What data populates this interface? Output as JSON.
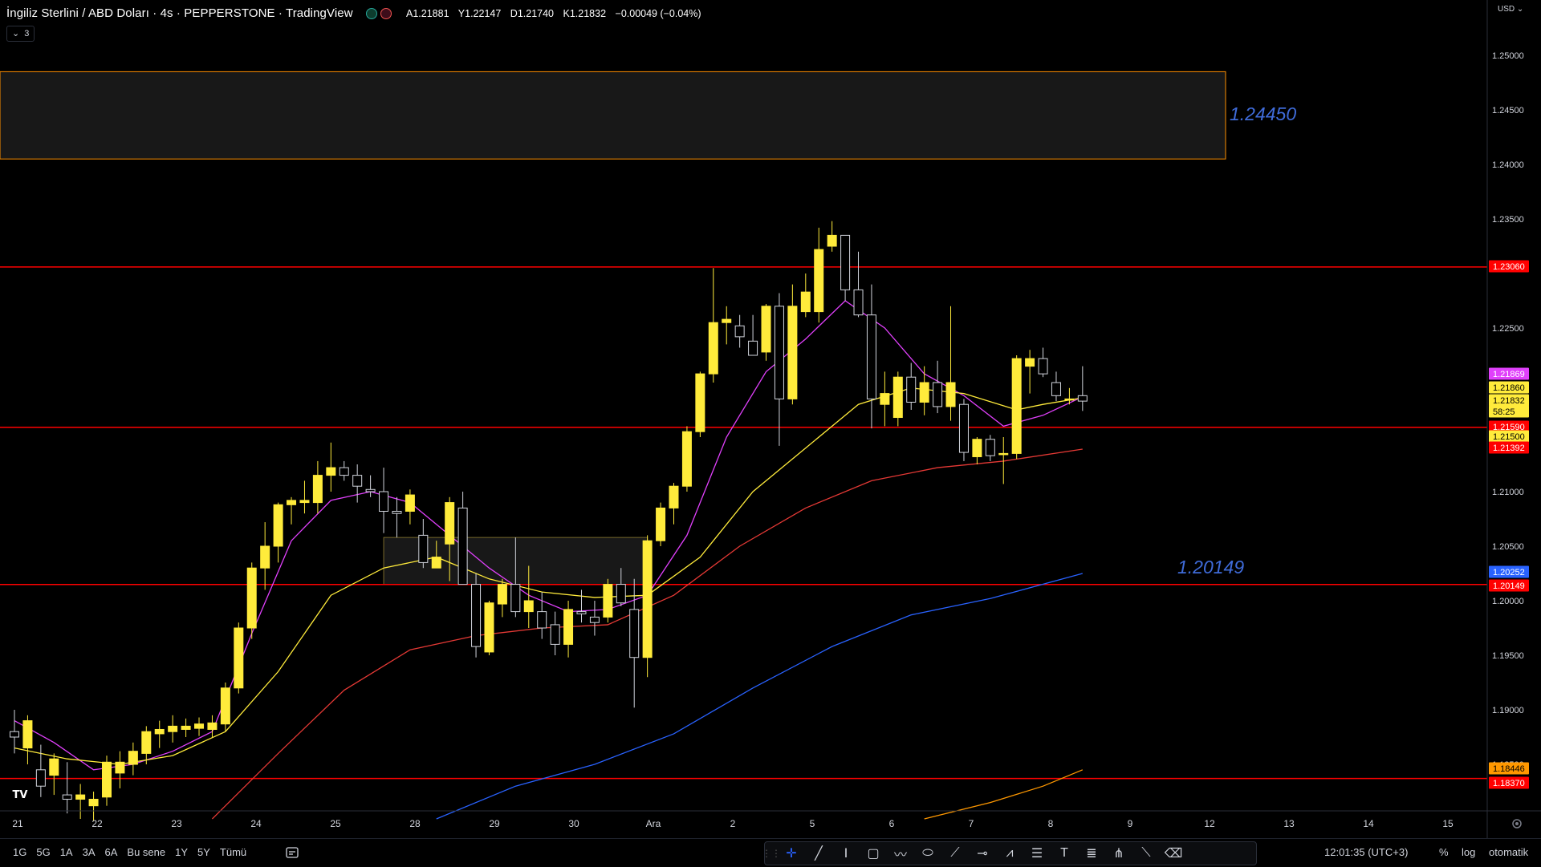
{
  "header": {
    "title": "İngiliz Sterlini / ABD Doları · 4s · PEPPERSTONE · TradingView",
    "ohlc": {
      "open": "A1.21881",
      "high": "Y1.22147",
      "low": "D1.21740",
      "close": "K1.21832",
      "change": "−0.00049 (−0.04%)"
    },
    "indicator_count": "3"
  },
  "price_scale": {
    "currency": "USD"
  },
  "annotations": {
    "upper_label": "1.24450",
    "lower_label": "1.20149"
  },
  "price_badges": [
    {
      "value": "1.23060",
      "color": "#ff0000"
    },
    {
      "value": "1.21869",
      "color": "#e040fb"
    },
    {
      "value": "1.21860",
      "color": "#ffeb3b"
    },
    {
      "value": "1.21832",
      "color": "#ffeb3b"
    },
    {
      "value": "58:25",
      "color": "#ffeb3b"
    },
    {
      "value": "1.21590",
      "color": "#ff0000"
    },
    {
      "value": "1.21500",
      "color": "#ffeb3b"
    },
    {
      "value": "1.21392",
      "color": "#ff0000"
    },
    {
      "value": "1.20252",
      "color": "#2962ff"
    },
    {
      "value": "1.20149",
      "color": "#ff0000"
    },
    {
      "value": "1.18446",
      "color": "#ff9800"
    },
    {
      "value": "1.18370",
      "color": "#ff0000"
    }
  ],
  "bottom_bar": {
    "ranges": [
      "1G",
      "5G",
      "1A",
      "3A",
      "6A",
      "Bu sene",
      "1Y",
      "5Y",
      "Tümü"
    ],
    "clock": "12:01:35 (UTC+3)",
    "percent": "%",
    "log": "log",
    "auto": "otomatik"
  },
  "drawing_tools": [
    "crosshair-icon",
    "trend-line-icon",
    "text-cursor-icon",
    "rectangle-icon",
    "brush-icon",
    "ellipse-icon",
    "path-icon",
    "horizontal-ray-icon",
    "zigzag-icon",
    "horizontal-lines-icon",
    "text-icon",
    "fib-icon",
    "pitchfork-icon",
    "ruler-icon",
    "eraser-icon"
  ],
  "chart_data": {
    "type": "candlestick",
    "symbol": "GBPUSD",
    "timeframe": "4s",
    "ylim": [
      1.18,
      1.2525
    ],
    "y_ticks": [
      1.25,
      1.245,
      1.24,
      1.235,
      1.225,
      1.21,
      1.205,
      1.2,
      1.195,
      1.19,
      1.185
    ],
    "x_ticks": [
      "21",
      "22",
      "23",
      "24",
      "25",
      "28",
      "29",
      "30",
      "Ara",
      "2",
      "5",
      "6",
      "7",
      "8",
      "9",
      "12",
      "13",
      "14",
      "15"
    ],
    "horizontal_levels": [
      1.2306,
      1.2159,
      1.20149,
      1.1837
    ],
    "zones": [
      {
        "from": 1.2405,
        "to": 1.2485
      },
      {
        "from": 1.2015,
        "to": 1.2058
      }
    ],
    "candles": [
      {
        "o": 1.188,
        "h": 1.19,
        "l": 1.186,
        "c": 1.1875
      },
      {
        "o": 1.1865,
        "h": 1.1895,
        "l": 1.185,
        "c": 1.189
      },
      {
        "o": 1.1845,
        "h": 1.1868,
        "l": 1.182,
        "c": 1.183
      },
      {
        "o": 1.184,
        "h": 1.186,
        "l": 1.1822,
        "c": 1.1855
      },
      {
        "o": 1.1822,
        "h": 1.1852,
        "l": 1.1805,
        "c": 1.1818
      },
      {
        "o": 1.1818,
        "h": 1.1832,
        "l": 1.18,
        "c": 1.1822
      },
      {
        "o": 1.1812,
        "h": 1.1825,
        "l": 1.1798,
        "c": 1.1818
      },
      {
        "o": 1.182,
        "h": 1.1858,
        "l": 1.1812,
        "c": 1.1852
      },
      {
        "o": 1.1842,
        "h": 1.1862,
        "l": 1.1828,
        "c": 1.1852
      },
      {
        "o": 1.185,
        "h": 1.187,
        "l": 1.184,
        "c": 1.1862
      },
      {
        "o": 1.186,
        "h": 1.1885,
        "l": 1.185,
        "c": 1.188
      },
      {
        "o": 1.1878,
        "h": 1.189,
        "l": 1.1865,
        "c": 1.1882
      },
      {
        "o": 1.188,
        "h": 1.1895,
        "l": 1.187,
        "c": 1.1885
      },
      {
        "o": 1.1882,
        "h": 1.1892,
        "l": 1.1875,
        "c": 1.1885
      },
      {
        "o": 1.1883,
        "h": 1.1893,
        "l": 1.1876,
        "c": 1.1887
      },
      {
        "o": 1.1882,
        "h": 1.1895,
        "l": 1.1875,
        "c": 1.1888
      },
      {
        "o": 1.1887,
        "h": 1.1925,
        "l": 1.188,
        "c": 1.192
      },
      {
        "o": 1.192,
        "h": 1.198,
        "l": 1.1915,
        "c": 1.1975
      },
      {
        "o": 1.1975,
        "h": 1.2035,
        "l": 1.1965,
        "c": 1.203
      },
      {
        "o": 1.203,
        "h": 1.2072,
        "l": 1.201,
        "c": 1.205
      },
      {
        "o": 1.205,
        "h": 1.209,
        "l": 1.2035,
        "c": 1.2088
      },
      {
        "o": 1.2088,
        "h": 1.2095,
        "l": 1.207,
        "c": 1.2092
      },
      {
        "o": 1.209,
        "h": 1.211,
        "l": 1.208,
        "c": 1.2092
      },
      {
        "o": 1.209,
        "h": 1.2128,
        "l": 1.208,
        "c": 1.2115
      },
      {
        "o": 1.2115,
        "h": 1.2145,
        "l": 1.21,
        "c": 1.2122
      },
      {
        "o": 1.2122,
        "h": 1.2128,
        "l": 1.211,
        "c": 1.2115
      },
      {
        "o": 1.2115,
        "h": 1.2125,
        "l": 1.209,
        "c": 1.2105
      },
      {
        "o": 1.2102,
        "h": 1.2115,
        "l": 1.2095,
        "c": 1.21
      },
      {
        "o": 1.21,
        "h": 1.2122,
        "l": 1.2062,
        "c": 1.2082
      },
      {
        "o": 1.2082,
        "h": 1.2095,
        "l": 1.2058,
        "c": 1.208
      },
      {
        "o": 1.2082,
        "h": 1.2102,
        "l": 1.207,
        "c": 1.2097
      },
      {
        "o": 1.206,
        "h": 1.2075,
        "l": 1.203,
        "c": 1.2035
      },
      {
        "o": 1.203,
        "h": 1.2055,
        "l": 1.203,
        "c": 1.204
      },
      {
        "o": 1.2052,
        "h": 1.2095,
        "l": 1.2018,
        "c": 1.209
      },
      {
        "o": 1.2085,
        "h": 1.21,
        "l": 1.204,
        "c": 1.2015
      },
      {
        "o": 1.2015,
        "h": 1.2025,
        "l": 1.1948,
        "c": 1.1958
      },
      {
        "o": 1.1953,
        "h": 1.2,
        "l": 1.195,
        "c": 1.1998
      },
      {
        "o": 1.1997,
        "h": 1.202,
        "l": 1.1985,
        "c": 1.2015
      },
      {
        "o": 1.2015,
        "h": 1.2058,
        "l": 1.1985,
        "c": 1.199
      },
      {
        "o": 1.199,
        "h": 1.2032,
        "l": 1.1975,
        "c": 1.2
      },
      {
        "o": 1.199,
        "h": 1.2008,
        "l": 1.1965,
        "c": 1.1975
      },
      {
        "o": 1.1978,
        "h": 1.199,
        "l": 1.195,
        "c": 1.196
      },
      {
        "o": 1.196,
        "h": 1.2,
        "l": 1.1948,
        "c": 1.1992
      },
      {
        "o": 1.199,
        "h": 1.201,
        "l": 1.198,
        "c": 1.1988
      },
      {
        "o": 1.1985,
        "h": 1.2,
        "l": 1.1968,
        "c": 1.198
      },
      {
        "o": 1.1985,
        "h": 1.202,
        "l": 1.198,
        "c": 1.2015
      },
      {
        "o": 1.2015,
        "h": 1.203,
        "l": 1.1995,
        "c": 1.1998
      },
      {
        "o": 1.1992,
        "h": 1.202,
        "l": 1.1902,
        "c": 1.1948
      },
      {
        "o": 1.1948,
        "h": 1.206,
        "l": 1.193,
        "c": 1.2055
      },
      {
        "o": 1.2055,
        "h": 1.209,
        "l": 1.205,
        "c": 1.2085
      },
      {
        "o": 1.2085,
        "h": 1.2108,
        "l": 1.207,
        "c": 1.2105
      },
      {
        "o": 1.2105,
        "h": 1.216,
        "l": 1.21,
        "c": 1.2155
      },
      {
        "o": 1.2155,
        "h": 1.221,
        "l": 1.215,
        "c": 1.2208
      },
      {
        "o": 1.2208,
        "h": 1.2305,
        "l": 1.22,
        "c": 1.2255
      },
      {
        "o": 1.2255,
        "h": 1.227,
        "l": 1.2235,
        "c": 1.2258
      },
      {
        "o": 1.2252,
        "h": 1.2262,
        "l": 1.2232,
        "c": 1.2242
      },
      {
        "o": 1.2238,
        "h": 1.2262,
        "l": 1.2225,
        "c": 1.2225
      },
      {
        "o": 1.2228,
        "h": 1.2272,
        "l": 1.222,
        "c": 1.227
      },
      {
        "o": 1.227,
        "h": 1.2282,
        "l": 1.2142,
        "c": 1.2185
      },
      {
        "o": 1.2185,
        "h": 1.229,
        "l": 1.218,
        "c": 1.227
      },
      {
        "o": 1.2265,
        "h": 1.23,
        "l": 1.226,
        "c": 1.2283
      },
      {
        "o": 1.2265,
        "h": 1.2342,
        "l": 1.2255,
        "c": 1.2322
      },
      {
        "o": 1.2325,
        "h": 1.2348,
        "l": 1.232,
        "c": 1.2335
      },
      {
        "o": 1.2335,
        "h": 1.2335,
        "l": 1.2275,
        "c": 1.2285
      },
      {
        "o": 1.2285,
        "h": 1.232,
        "l": 1.226,
        "c": 1.2262
      },
      {
        "o": 1.2262,
        "h": 1.229,
        "l": 1.2158,
        "c": 1.2185
      },
      {
        "o": 1.218,
        "h": 1.221,
        "l": 1.216,
        "c": 1.219
      },
      {
        "o": 1.2168,
        "h": 1.221,
        "l": 1.216,
        "c": 1.2205
      },
      {
        "o": 1.2205,
        "h": 1.2218,
        "l": 1.2175,
        "c": 1.2182
      },
      {
        "o": 1.2182,
        "h": 1.2215,
        "l": 1.217,
        "c": 1.22
      },
      {
        "o": 1.22,
        "h": 1.222,
        "l": 1.2172,
        "c": 1.2178
      },
      {
        "o": 1.2178,
        "h": 1.227,
        "l": 1.2165,
        "c": 1.22
      },
      {
        "o": 1.218,
        "h": 1.2185,
        "l": 1.2128,
        "c": 1.2136
      },
      {
        "o": 1.2132,
        "h": 1.215,
        "l": 1.2125,
        "c": 1.2148
      },
      {
        "o": 1.2148,
        "h": 1.2152,
        "l": 1.2128,
        "c": 1.2133
      },
      {
        "o": 1.2135,
        "h": 1.215,
        "l": 1.2107,
        "c": 1.2135
      },
      {
        "o": 1.2135,
        "h": 1.2225,
        "l": 1.213,
        "c": 1.2222
      },
      {
        "o": 1.2215,
        "h": 1.223,
        "l": 1.219,
        "c": 1.2222
      },
      {
        "o": 1.2222,
        "h": 1.2232,
        "l": 1.2205,
        "c": 1.2208
      },
      {
        "o": 1.22,
        "h": 1.221,
        "l": 1.2183,
        "c": 1.2188
      },
      {
        "o": 1.2185,
        "h": 1.2195,
        "l": 1.218,
        "c": 1.2185
      },
      {
        "o": 1.2188,
        "h": 1.2215,
        "l": 1.2174,
        "c": 1.2183
      }
    ],
    "moving_averages": [
      {
        "color": "#e040fb",
        "points": [
          [
            0,
            1.189
          ],
          [
            3,
            1.187
          ],
          [
            6,
            1.1845
          ],
          [
            9,
            1.185
          ],
          [
            12,
            1.1862
          ],
          [
            15,
            1.188
          ],
          [
            18,
            1.197
          ],
          [
            21,
            1.2055
          ],
          [
            24,
            1.2092
          ],
          [
            27,
            1.21
          ],
          [
            30,
            1.209
          ],
          [
            33,
            1.206
          ],
          [
            36,
            1.203
          ],
          [
            39,
            1.2005
          ],
          [
            42,
            1.199
          ],
          [
            45,
            1.1992
          ],
          [
            48,
            1.2005
          ],
          [
            51,
            1.206
          ],
          [
            54,
            1.215
          ],
          [
            57,
            1.221
          ],
          [
            60,
            1.224
          ],
          [
            63,
            1.2275
          ],
          [
            66,
            1.225
          ],
          [
            69,
            1.2208
          ],
          [
            72,
            1.2188
          ],
          [
            75,
            1.216
          ],
          [
            78,
            1.217
          ],
          [
            81,
            1.2187
          ]
        ]
      },
      {
        "color": "#ffeb3b",
        "points": [
          [
            0,
            1.1865
          ],
          [
            4,
            1.1855
          ],
          [
            8,
            1.185
          ],
          [
            12,
            1.1858
          ],
          [
            16,
            1.188
          ],
          [
            20,
            1.1935
          ],
          [
            24,
            1.2005
          ],
          [
            28,
            1.203
          ],
          [
            32,
            1.204
          ],
          [
            36,
            1.202
          ],
          [
            40,
            1.2008
          ],
          [
            44,
            1.2003
          ],
          [
            48,
            1.2005
          ],
          [
            52,
            1.204
          ],
          [
            56,
            1.21
          ],
          [
            60,
            1.214
          ],
          [
            64,
            1.218
          ],
          [
            68,
            1.2195
          ],
          [
            72,
            1.219
          ],
          [
            76,
            1.2175
          ],
          [
            78,
            1.218
          ],
          [
            81,
            1.2186
          ]
        ]
      },
      {
        "color": "#e53935",
        "points": [
          [
            15,
            1.18
          ],
          [
            20,
            1.186
          ],
          [
            25,
            1.1918
          ],
          [
            30,
            1.1955
          ],
          [
            35,
            1.1968
          ],
          [
            40,
            1.1975
          ],
          [
            45,
            1.1978
          ],
          [
            50,
            1.2005
          ],
          [
            55,
            1.205
          ],
          [
            60,
            1.2085
          ],
          [
            65,
            1.211
          ],
          [
            70,
            1.2122
          ],
          [
            75,
            1.2128
          ],
          [
            81,
            1.2139
          ]
        ]
      },
      {
        "color": "#2962ff",
        "points": [
          [
            32,
            1.18
          ],
          [
            38,
            1.183
          ],
          [
            44,
            1.185
          ],
          [
            50,
            1.1878
          ],
          [
            56,
            1.192
          ],
          [
            62,
            1.1958
          ],
          [
            68,
            1.1987
          ],
          [
            74,
            1.2002
          ],
          [
            81,
            1.2025
          ]
        ]
      },
      {
        "color": "#ff9800",
        "points": [
          [
            69,
            1.18
          ],
          [
            74,
            1.1815
          ],
          [
            78,
            1.183
          ],
          [
            81,
            1.1845
          ]
        ]
      }
    ]
  }
}
